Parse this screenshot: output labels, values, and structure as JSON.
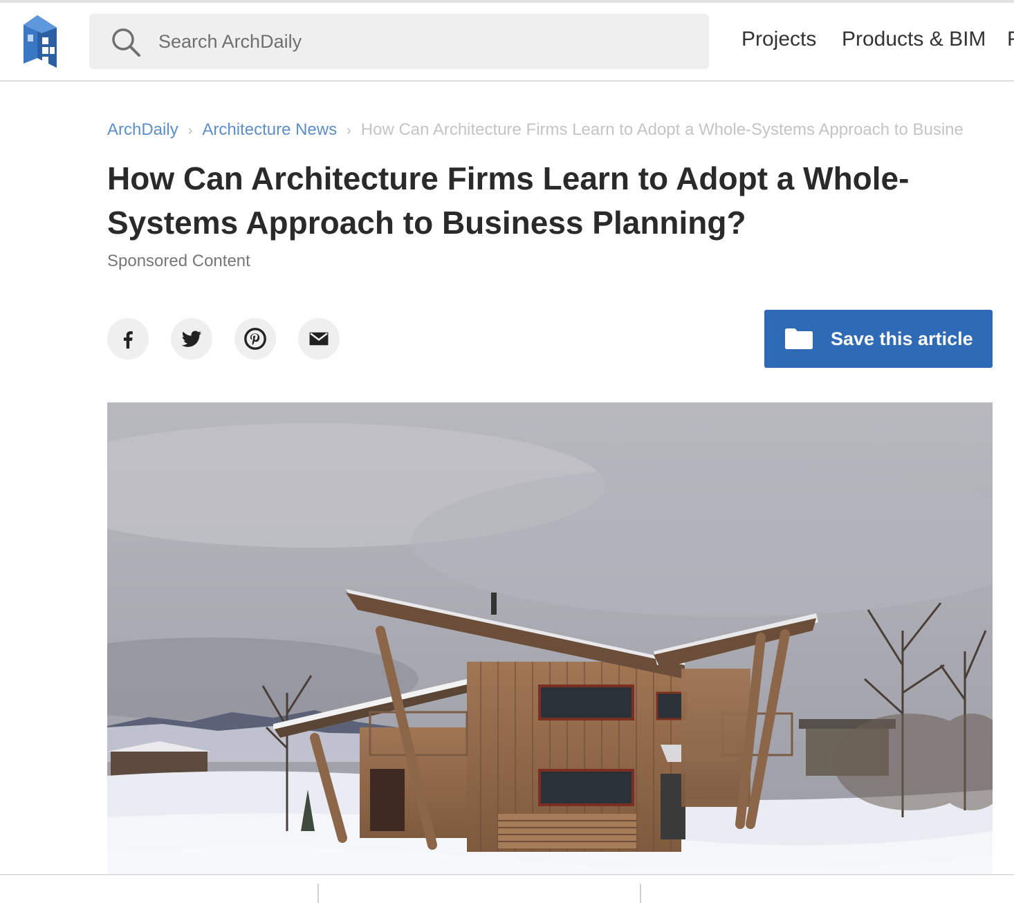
{
  "header": {
    "logo_alt": "ArchDaily",
    "search": {
      "placeholder": "Search ArchDaily"
    },
    "nav": {
      "projects": "Projects",
      "products": "Products & BIM",
      "more": "F"
    }
  },
  "breadcrumb": {
    "home": "ArchDaily",
    "section": "Architecture News",
    "current": "How Can Architecture Firms Learn to Adopt a Whole-Systems Approach to Busine"
  },
  "article": {
    "title": "How Can Architecture Firms Learn to Adopt a Whole-Systems Approach to Business Planning?",
    "subtitle": "Sponsored Content",
    "save_label": "Save this article"
  },
  "share_icons": [
    "facebook-icon",
    "twitter-icon",
    "pinterest-icon",
    "email-icon"
  ],
  "colors": {
    "accent": "#2f6ab7",
    "link": "#5d8ec6"
  }
}
